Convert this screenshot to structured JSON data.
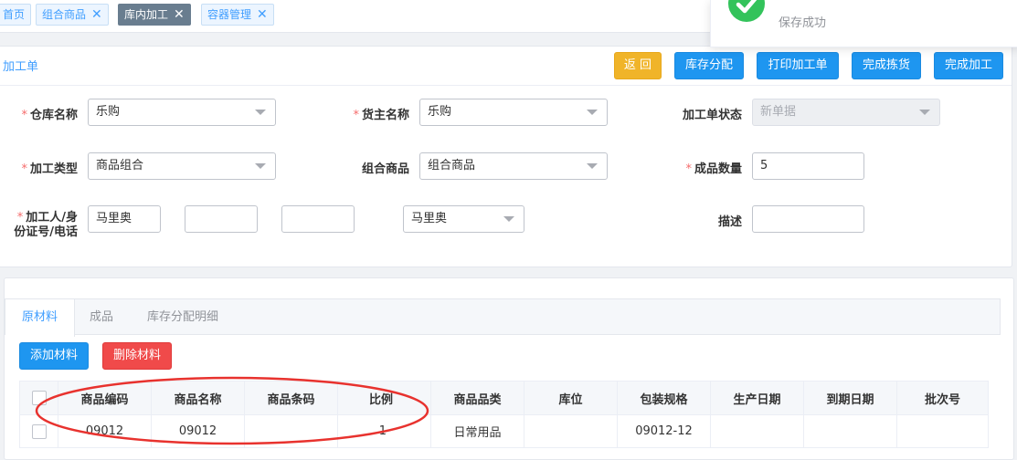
{
  "tags": [
    {
      "label": "首页",
      "closable": false,
      "active": false
    },
    {
      "label": "组合商品",
      "closable": true,
      "active": false
    },
    {
      "label": "库内加工",
      "closable": true,
      "active": true
    },
    {
      "label": "容器管理",
      "closable": true,
      "active": false
    }
  ],
  "tag_close_glyph": "✕",
  "toast": {
    "message": "保存成功",
    "icon": "check-circle-icon",
    "color": "#33c35b"
  },
  "form_card": {
    "title": "加工单",
    "buttons": {
      "back": "返 回",
      "allocate": "库存分配",
      "print": "打印加工单",
      "finish_pick": "完成拣货",
      "finish_process": "完成加工"
    },
    "fields": {
      "warehouse": {
        "label": "仓库名称",
        "required": true,
        "value": "乐购"
      },
      "owner": {
        "label": "货主名称",
        "required": true,
        "value": "乐购"
      },
      "status": {
        "label": "加工单状态",
        "required": false,
        "value": "新单据"
      },
      "process_type": {
        "label": "加工类型",
        "required": true,
        "value": "商品组合"
      },
      "combo_goods": {
        "label": "组合商品",
        "required": false,
        "value": "组合商品"
      },
      "quantity": {
        "label": "成品数量",
        "required": true,
        "value": "5"
      },
      "processor": {
        "label_line1": "加工人/身",
        "label_line2": "份证号/电话",
        "required": true,
        "name": "马里奥",
        "id_number": "",
        "phone": "",
        "select": "马里奥"
      },
      "description": {
        "label": "描述",
        "required": false,
        "value": ""
      }
    }
  },
  "detail_card": {
    "tabs": [
      "原材料",
      "成品",
      "库存分配明细"
    ],
    "active_tab": 0,
    "buttons": {
      "add": "添加材料",
      "delete": "删除材料"
    },
    "table": {
      "columns": [
        "商品编码",
        "商品名称",
        "商品条码",
        "比例",
        "商品品类",
        "库位",
        "包装规格",
        "生产日期",
        "到期日期",
        "批次号"
      ],
      "rows": [
        [
          "09012",
          "09012",
          "",
          "1",
          "日常用品",
          "",
          "09012-12",
          "",
          "",
          ""
        ]
      ]
    }
  },
  "colors": {
    "primary": "#1e96f0",
    "warning": "#f0b429",
    "danger": "#f04a4a",
    "required": "#f56c6c",
    "annotation": "#e8322e"
  }
}
